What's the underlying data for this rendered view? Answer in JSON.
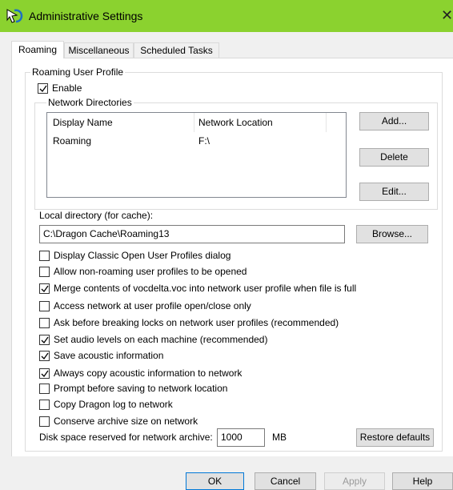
{
  "window": {
    "title": "Administrative Settings",
    "close_glyph": "✕"
  },
  "tabs": [
    {
      "label": "Roaming",
      "active": true
    },
    {
      "label": "Miscellaneous",
      "active": false
    },
    {
      "label": "Scheduled Tasks",
      "active": false
    }
  ],
  "roaming_profile": {
    "legend": "Roaming User Profile",
    "enable": {
      "label": "Enable",
      "checked": true
    },
    "network_directories": {
      "legend": "Network Directories",
      "columns": [
        "Display Name",
        "Network Location"
      ],
      "rows": [
        {
          "display_name": "Roaming",
          "location": "F:\\"
        }
      ],
      "buttons": {
        "add": "Add...",
        "delete": "Delete",
        "edit": "Edit..."
      }
    },
    "local_directory": {
      "label": "Local directory (for cache):",
      "value": "C:\\Dragon Cache\\Roaming13",
      "browse": "Browse..."
    },
    "options": [
      {
        "label": "Display Classic Open User Profiles dialog",
        "checked": false
      },
      {
        "label": "Allow non-roaming user profiles to be opened",
        "checked": false
      },
      {
        "label": "Merge contents of vocdelta.voc into network user profile when file is full",
        "checked": true
      },
      {
        "label": "Access network at user profile open/close only",
        "checked": false
      },
      {
        "label": "Ask before breaking locks on network user profiles (recommended)",
        "checked": false
      },
      {
        "label": "Set audio levels on each machine (recommended)",
        "checked": true
      },
      {
        "label": "Save acoustic information",
        "checked": true
      },
      {
        "label": "Always copy acoustic information to network",
        "checked": true
      },
      {
        "label": "Prompt before saving to network location",
        "checked": false
      },
      {
        "label": "Copy Dragon log to network",
        "checked": false
      },
      {
        "label": "Conserve archive size on network",
        "checked": false
      }
    ],
    "disk_space": {
      "label": "Disk space reserved for network archive:",
      "value": "1000",
      "unit": "MB"
    },
    "restore_defaults": "Restore defaults"
  },
  "footer": {
    "ok": "OK",
    "cancel": "Cancel",
    "apply": "Apply",
    "help": "Help"
  },
  "colors": {
    "titlebar": "#8bd22f",
    "panel": "#ffffff",
    "button": "#e1e1e1",
    "focus_border": "#0078d7"
  }
}
